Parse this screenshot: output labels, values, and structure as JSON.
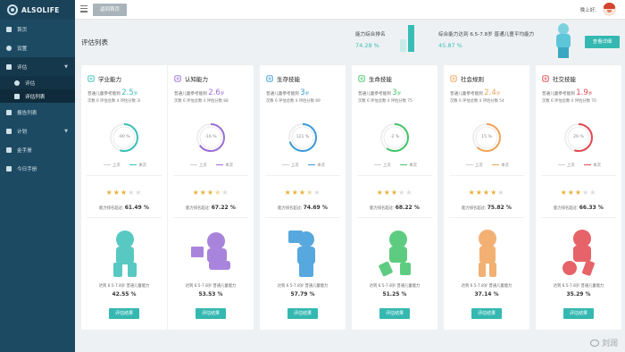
{
  "app": {
    "logo_text": "ALSOLIFE"
  },
  "sidebar": {
    "items": [
      {
        "label": "首页",
        "icon": "home-icon"
      },
      {
        "label": "设置",
        "icon": "settings-icon"
      },
      {
        "label": "评估",
        "icon": "assessment-icon",
        "open": true,
        "children": [
          {
            "label": "评估",
            "icon": "person-icon"
          },
          {
            "label": "评估列表",
            "icon": "list-icon",
            "active": true
          }
        ]
      },
      {
        "label": "报告列表",
        "icon": "report-icon"
      },
      {
        "label": "计划",
        "icon": "plan-icon"
      },
      {
        "label": "金手册",
        "icon": "book-icon"
      },
      {
        "label": "今日手册",
        "icon": "calendar-icon"
      }
    ]
  },
  "topbar": {
    "back_label": "返回首页",
    "greeting": "晚上好,"
  },
  "header": {
    "title": "评估列表",
    "rank_label": "能力综合排名",
    "rank_value": "74.28 %",
    "avg_label": "综合能力达到 6.5-7.8岁 普通儿童平均能力",
    "avg_value": "45.87 %",
    "detail_button": "查看详细"
  },
  "cards": [
    {
      "title": "学业能力",
      "accent": "#3bbfb8",
      "age_prefix": "普通儿童参考能到",
      "age": "2.5",
      "age_unit": "岁",
      "stats": "次数 6   评估总数 4   评估分数 3l",
      "ring_text": "-90 %",
      "ring_pct": 0.55,
      "legend_prev": "上次",
      "legend_cur": "本次",
      "stars": 3,
      "score_label": "能力排名超过:",
      "score": "61.49 %",
      "figure": "child-green",
      "reach_label": "达到 6.5-7.8岁 普通儿童能力",
      "reach": "42.55 %",
      "button": "评估结果",
      "icon": "book-icon"
    },
    {
      "title": "认知能力",
      "accent": "#9b6fd6",
      "age_prefix": "普通儿童参考能到",
      "age": "2.6",
      "age_unit": "岁",
      "stats": "次数 6   评估总数 4   评估分数 88",
      "ring_text": "-16 %",
      "ring_pct": 0.65,
      "legend_prev": "上次",
      "legend_cur": "本次",
      "stars": 3.5,
      "score_label": "能力排名超过:",
      "score": "67.22 %",
      "figure": "child-purple",
      "reach_label": "达到 6.5-7.8岁 普通儿童能力",
      "reach": "53.53 %",
      "button": "评估结果",
      "icon": "brain-icon"
    },
    {
      "title": "生存技能",
      "accent": "#3a9ad9",
      "age_prefix": "普通儿童参考能到",
      "age": "3",
      "age_unit": "岁",
      "stats": "次数 6   评估总数 4   评估分数 89",
      "ring_text": "121 %",
      "ring_pct": 0.7,
      "legend_prev": "上次",
      "legend_cur": "本次",
      "stars": 3.5,
      "score_label": "能力排名超过:",
      "score": "74.69 %",
      "figure": "child-blue",
      "reach_label": "达到 6.5-7.8岁 普通儿童能力",
      "reach": "57.79 %",
      "button": "评估结果",
      "icon": "house-icon"
    },
    {
      "title": "生命技能",
      "accent": "#43c46a",
      "age_prefix": "普通儿童参考能到",
      "age": "3",
      "age_unit": "岁",
      "stats": "次数 6   评估总数 4   评估分数 75",
      "ring_text": "-2 %",
      "ring_pct": 0.6,
      "legend_prev": "上次",
      "legend_cur": "本次",
      "stars": 3,
      "score_label": "能力排名超过:",
      "score": "68.22 %",
      "figure": "child-lightgreen",
      "reach_label": "达到 6.5-7.8岁 普通儿童能力",
      "reach": "51.25 %",
      "button": "评估结果",
      "icon": "heart-icon"
    },
    {
      "title": "社会规则",
      "accent": "#f0a35a",
      "age_prefix": "普通儿童参考能到",
      "age": "2.4",
      "age_unit": "岁",
      "stats": "次数 6   评估总数 4   评估分数 54",
      "ring_text": "15 %",
      "ring_pct": 0.62,
      "legend_prev": "上次",
      "legend_cur": "本次",
      "stars": 4,
      "score_label": "能力排名超过:",
      "score": "75.82 %",
      "figure": "child-orange",
      "reach_label": "达到 6.5-7.8岁 普通儿童能力",
      "reach": "37.14 %",
      "button": "评估结果",
      "icon": "rules-icon"
    },
    {
      "title": "社交技能",
      "accent": "#e2484f",
      "age_prefix": "普通儿童参考能到",
      "age": "1.9",
      "age_unit": "岁",
      "stats": "次数 6   评估总数 4   评估分数 70",
      "ring_text": "26 %",
      "ring_pct": 0.55,
      "legend_prev": "上次",
      "legend_cur": "本次",
      "stars": 3,
      "score_label": "能力排名超过:",
      "score": "66.33 %",
      "figure": "child-red",
      "reach_label": "达到 6.5-7.8岁 普通儿童能力",
      "reach": "35.29 %",
      "button": "评估结果",
      "icon": "social-icon"
    }
  ],
  "watermark": "刘润"
}
